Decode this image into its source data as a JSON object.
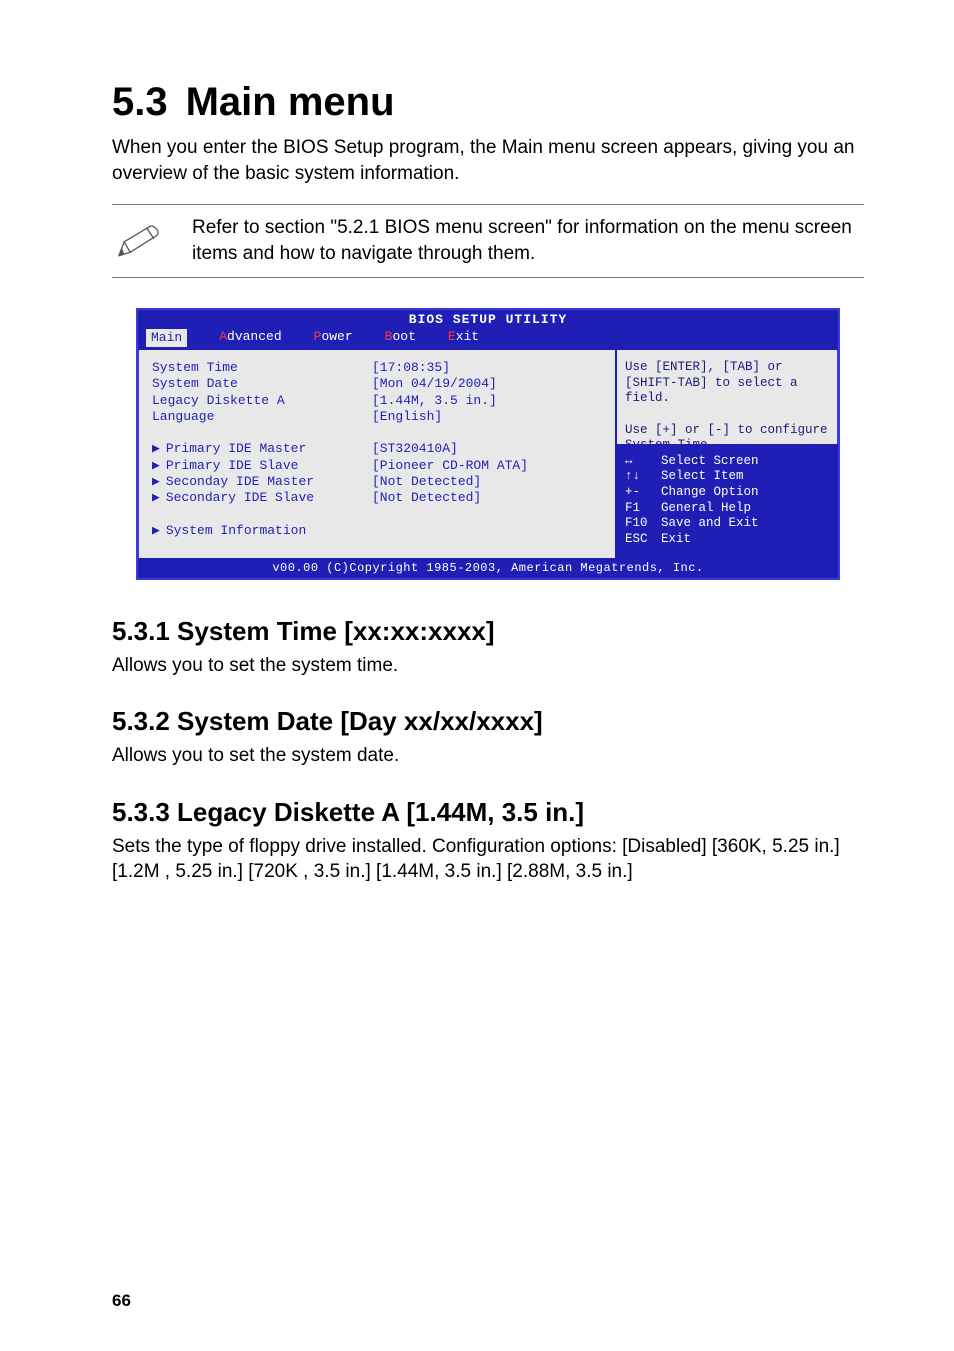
{
  "header": {
    "number": "5.3",
    "title": "Main menu"
  },
  "intro": "When you enter the BIOS Setup program, the Main menu screen appears, giving you an overview of the basic system information.",
  "note": "Refer to section \"5.2.1  BIOS menu screen\" for information on the menu screen items and how to navigate through them.",
  "bios": {
    "title": "BIOS SETUP UTILITY",
    "menu": [
      "Main",
      "Advanced",
      "Power",
      "Boot",
      "Exit"
    ],
    "selected_menu_index": 0,
    "main_items": [
      {
        "label": "System Time",
        "value": "[17:08:35]",
        "submenu": false
      },
      {
        "label": "System Date",
        "value": "[Mon 04/19/2004]",
        "submenu": false
      },
      {
        "label": "Legacy Diskette A",
        "value": "[1.44M, 3.5 in.]",
        "submenu": false
      },
      {
        "label": "Language",
        "value": "[English]",
        "submenu": false
      },
      {
        "label": "",
        "value": "",
        "submenu": false
      },
      {
        "label": "Primary IDE Master",
        "value": "[ST320410A]",
        "submenu": true
      },
      {
        "label": "Primary IDE Slave",
        "value": "[Pioneer CD-ROM ATA]",
        "submenu": true
      },
      {
        "label": "Seconday IDE Master",
        "value": "[Not Detected]",
        "submenu": true
      },
      {
        "label": "Secondary IDE Slave",
        "value": "[Not Detected]",
        "submenu": true
      },
      {
        "label": "",
        "value": "",
        "submenu": false
      },
      {
        "label": "System Information",
        "value": "",
        "submenu": true
      }
    ],
    "help_upper": "Use [ENTER], [TAB] or [SHIFT-TAB] to select a field.\n\nUse [+] or [-] to configure System Time.",
    "keys": [
      {
        "k": "↔",
        "d": "Select Screen"
      },
      {
        "k": "↑↓",
        "d": "Select Item"
      },
      {
        "k": "+-",
        "d": "Change Option"
      },
      {
        "k": "F1",
        "d": "General Help"
      },
      {
        "k": "F10",
        "d": "Save and Exit"
      },
      {
        "k": "ESC",
        "d": "Exit"
      }
    ],
    "footer": "v00.00 (C)Copyright 1985-2003, American Megatrends, Inc."
  },
  "sections": [
    {
      "num": "5.3.1",
      "title": "System Time [xx:xx:xxxx]",
      "body": "Allows you to set the system time."
    },
    {
      "num": "5.3.2",
      "title": "System Date [Day xx/xx/xxxx]",
      "body": "Allows you to set the system date."
    },
    {
      "num": "5.3.3",
      "title": "Legacy Diskette A [1.44M, 3.5 in.]",
      "body": "Sets the type of floppy drive installed. Configuration options: [Disabled] [360K, 5.25 in.] [1.2M , 5.25 in.] [720K , 3.5 in.] [1.44M, 3.5 in.] [2.88M, 3.5  in.]"
    }
  ],
  "page_number": "66"
}
